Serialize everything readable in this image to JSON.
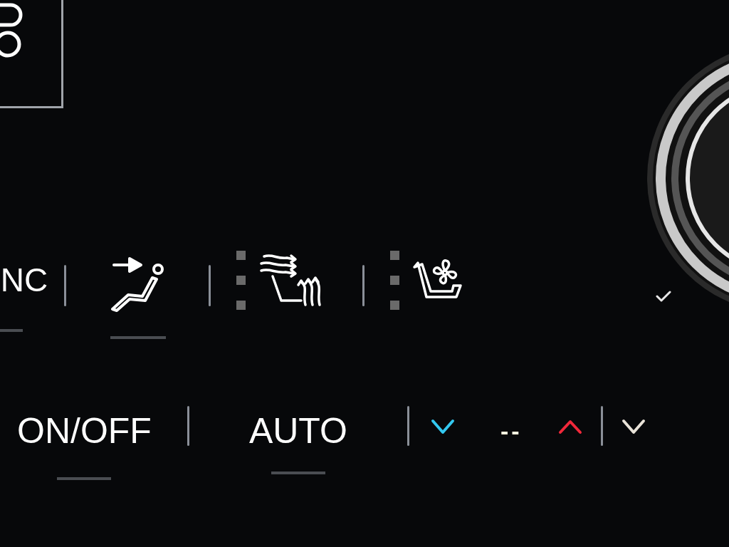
{
  "row_1": [
    {
      "kind": "label",
      "label": "NC"
    },
    {
      "kind": "recline"
    },
    {
      "kind": "seat_heat"
    },
    {
      "kind": "seat_vent"
    }
  ],
  "row_2": [
    {
      "kind": "label",
      "label": "ON/OFF"
    },
    {
      "kind": "label",
      "label": "AUTO"
    },
    {
      "kind": "fan_down"
    },
    {
      "kind": "reading",
      "label": "--"
    },
    {
      "kind": "temp_up"
    },
    {
      "kind": "temp_down"
    }
  ]
}
